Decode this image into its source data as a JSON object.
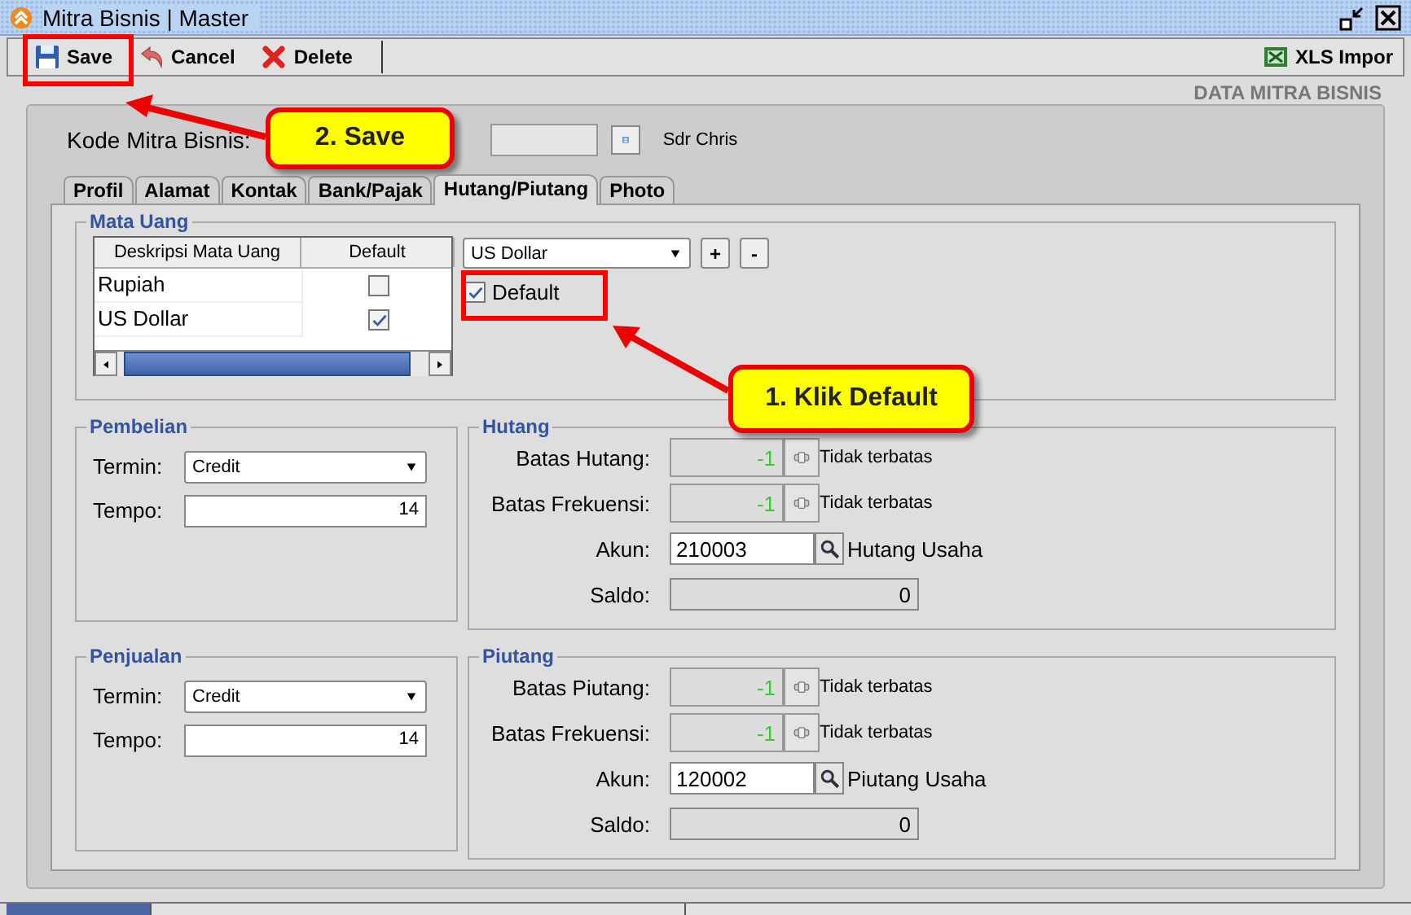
{
  "window": {
    "title": "Mitra Bisnis | Master"
  },
  "toolbar": {
    "buttons": [
      {
        "label": "Save",
        "kind": "save"
      },
      {
        "label": "Cancel",
        "kind": "cancel"
      },
      {
        "label": "Delete",
        "kind": "delete"
      }
    ],
    "right_button": {
      "label": "XLS Impor",
      "kind": "excel"
    }
  },
  "header": "DATA MITRA BISNIS",
  "kode": {
    "label": "Kode Mitra Bisnis:",
    "name": "Sdr Chris"
  },
  "tabs": [
    {
      "label": "Profil",
      "selected": false
    },
    {
      "label": "Alamat",
      "selected": false
    },
    {
      "label": "Kontak",
      "selected": false
    },
    {
      "label": "Bank/Pajak",
      "selected": false
    },
    {
      "label": "Hutang/Piutang",
      "selected": true
    },
    {
      "label": "Photo",
      "selected": false
    }
  ],
  "mata_uang": {
    "title": "Mata Uang",
    "columns": [
      "Deskripsi Mata Uang",
      "Default"
    ],
    "rows": [
      {
        "name": "Rupiah",
        "default": false
      },
      {
        "name": "US Dollar",
        "default": true
      }
    ],
    "currency": "US Dollar",
    "add": "+",
    "remove": "-",
    "default_checkbox": {
      "label": "Default",
      "checked": true
    }
  },
  "sections": [
    {
      "purchase": {
        "title": "Pembelian",
        "termin_label": "Termin:",
        "termin": "Credit",
        "tempo_label": "Tempo:",
        "tempo": "14"
      },
      "balance": {
        "title": "Hutang",
        "rows": [
          {
            "kind": "limit",
            "label": "Batas Hutang:",
            "value": "-1",
            "note": "Tidak terbatas"
          },
          {
            "kind": "limit",
            "label": "Batas Frekuensi:",
            "value": "-1",
            "note": "Tidak terbatas"
          },
          {
            "kind": "account",
            "label": "Akun:",
            "value": "210003",
            "note": "Hutang Usaha"
          },
          {
            "kind": "saldo",
            "label": "Saldo:",
            "value": "0"
          }
        ]
      }
    },
    {
      "purchase": {
        "title": "Penjualan",
        "termin_label": "Termin:",
        "termin": "Credit",
        "tempo_label": "Tempo:",
        "tempo": "14"
      },
      "balance": {
        "title": "Piutang",
        "rows": [
          {
            "kind": "limit",
            "label": "Batas Piutang:",
            "value": "-1",
            "note": "Tidak terbatas"
          },
          {
            "kind": "limit",
            "label": "Batas Frekuensi:",
            "value": "-1",
            "note": "Tidak terbatas"
          },
          {
            "kind": "account",
            "label": "Akun:",
            "value": "120002",
            "note": "Piutang Usaha"
          },
          {
            "kind": "saldo",
            "label": "Saldo:",
            "value": "0"
          }
        ]
      }
    }
  ],
  "callouts": [
    {
      "text": "2. Save"
    },
    {
      "text": "1. Klik Default"
    }
  ]
}
